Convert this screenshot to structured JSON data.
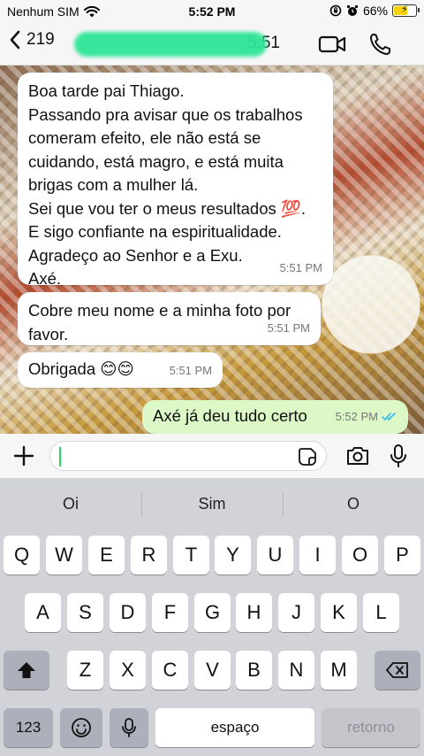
{
  "status_bar": {
    "carrier": "Nenhum SIM",
    "time": "5:52 PM",
    "battery": "66%",
    "battery_level": 0.66,
    "icons": [
      "wifi-icon",
      "orientation-lock-icon",
      "alarm-icon",
      "battery-charging-icon"
    ]
  },
  "header": {
    "back_count": "219",
    "contact_name_suffix": "5:51",
    "icons": [
      "back-chevron-icon",
      "video-call-icon",
      "voice-call-icon"
    ],
    "redaction_color": "#2fe596"
  },
  "messages": [
    {
      "direction": "in",
      "text": "Boa tarde pai Thiago.\nPassando pra avisar que os trabalhos comeram efeito, ele não  está se cuidando, está magro, e está muita brigas com a mulher lá.\nSei que vou ter o meus resultados 💯.\nE sigo confiante na espiritualidade.\nAgradeço ao Senhor e a Exu.\nAxé.",
      "time": "5:51 PM"
    },
    {
      "direction": "in",
      "text": "Cobre meu nome e a minha foto por favor.",
      "time": "5:51 PM"
    },
    {
      "direction": "in",
      "text": "Obrigada 😊😊",
      "time": "5:51 PM"
    },
    {
      "direction": "out",
      "text": "Axé já deu tudo certo",
      "time": "5:52 PM",
      "status": "read-double-check-icon"
    }
  ],
  "input_bar": {
    "placeholder": "",
    "icons": [
      "plus-icon",
      "sticker-icon",
      "camera-icon",
      "microphone-icon"
    ]
  },
  "keyboard": {
    "suggestions": [
      "Oi",
      "Sim",
      "O"
    ],
    "row1": [
      "Q",
      "W",
      "E",
      "R",
      "T",
      "Y",
      "U",
      "I",
      "O",
      "P"
    ],
    "row2": [
      "A",
      "S",
      "D",
      "F",
      "G",
      "H",
      "J",
      "K",
      "L"
    ],
    "row3": [
      "Z",
      "X",
      "C",
      "V",
      "B",
      "N",
      "M"
    ],
    "numbers_key": "123",
    "space_key": "espaço",
    "return_key": "retorno",
    "icons": [
      "shift-icon",
      "backspace-icon",
      "emoji-icon",
      "dictation-mic-icon"
    ]
  },
  "colors": {
    "incoming_bubble": "#ffffff",
    "outgoing_bubble": "#dcf8c6",
    "accent": "#25d366",
    "read_ticks": "#34b7f1",
    "keyboard_bg": "#d1d3d9"
  }
}
